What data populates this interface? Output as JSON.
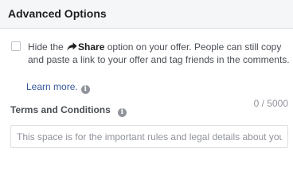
{
  "header": {
    "title": "Advanced Options"
  },
  "share_option": {
    "checked": false,
    "text_before": "Hide the",
    "share_word": "Share",
    "text_after": "option on your offer. People can still copy and paste a link to your offer and tag friends in the comments.",
    "learn_more": "Learn more.",
    "share_icon": "share-arrow-icon",
    "info_icon": "info-icon"
  },
  "terms": {
    "label": "Terms and Conditions",
    "char_count": "0 / 5000",
    "placeholder": "This space is for the important rules and legal details about your offer",
    "value": "",
    "info_icon": "info-icon"
  },
  "colors": {
    "header_background": "#f5f6f7",
    "link": "#365899",
    "muted_text": "#90949c",
    "border": "#dddfe2"
  }
}
